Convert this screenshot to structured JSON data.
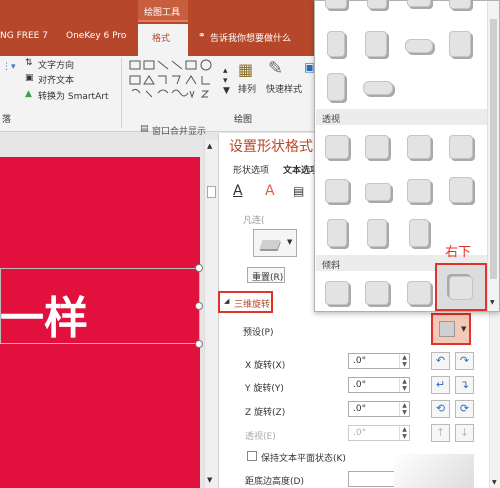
{
  "ribbon_tabs": {
    "context_group": "绘图工具",
    "tab1": "NG FREE 7",
    "tab2": "OneKey 6 Pro",
    "tab3": "格式",
    "tell_me": "告诉我你想要做什么"
  },
  "ribbon": {
    "text_direction": "文字方向",
    "align_text": "对齐文本",
    "convert_smartart": "转换为 SmartArt",
    "arrange": "排列",
    "quick_styles": "快速样式",
    "group_paragraph": "落",
    "group_drawing": "绘图"
  },
  "slide": {
    "window_merge": "窗口合并显示",
    "text": "一样"
  },
  "pane": {
    "title": "设置形状格式",
    "tab_shape": "形状选项",
    "tab_text": "文本选项",
    "cut_label": "凡连(",
    "reset": "重置(R)",
    "section": "三维旋转",
    "preset": "预设(P)",
    "x_rot": "X 旋转(X)",
    "y_rot": "Y 旋转(Y)",
    "z_rot": "Z 旋转(Z)",
    "perspective": "透视(E)",
    "x_val": ".0°",
    "y_val": ".0°",
    "z_val": ".0°",
    "p_val": ".0°",
    "keep_flat": "保持文本平面状态(K)",
    "distance": "距底边高度(D)"
  },
  "gallery": {
    "section_perspective": "透视",
    "section_oblique": "倾斜",
    "annotation": "右下"
  },
  "colors": {
    "ribbon": "#b7472a",
    "slide": "#e2103c",
    "pane_title": "#b7472a",
    "highlight": "#e0342a"
  }
}
